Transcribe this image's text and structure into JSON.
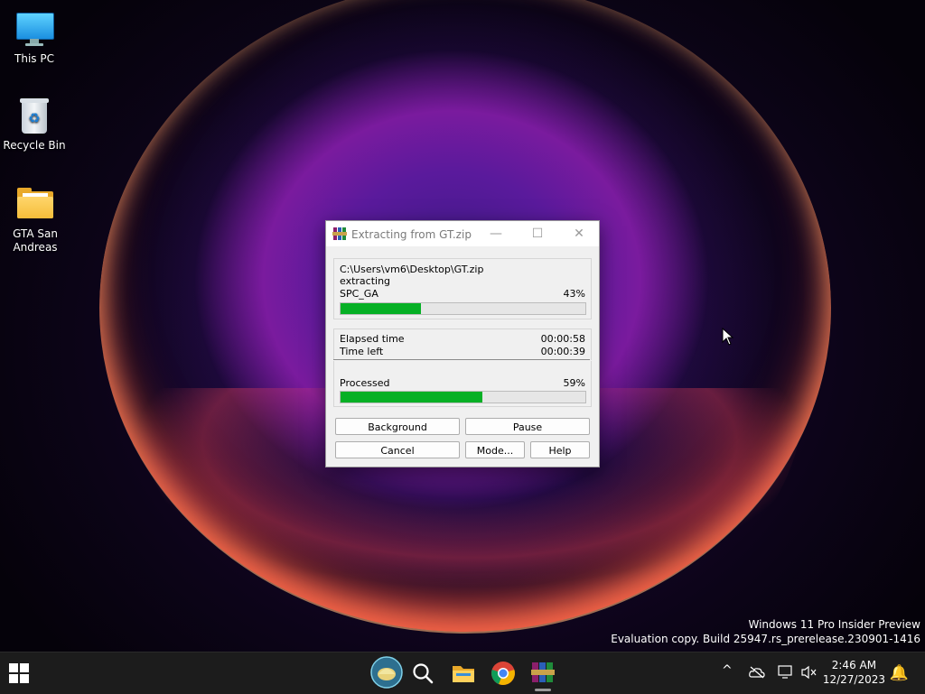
{
  "desktop": {
    "icons": [
      {
        "label": "This PC"
      },
      {
        "label": "Recycle Bin"
      },
      {
        "label": "GTA San Andreas"
      }
    ]
  },
  "dialog": {
    "title": "Extracting from GT.zip",
    "archive_path": "C:\\Users\\vm6\\Desktop\\GT.zip",
    "operation": "extracting",
    "current_file": "SPC_GA",
    "file_percent_label": "43%",
    "file_progress": 0.33,
    "elapsed_label": "Elapsed time",
    "elapsed_value": "00:00:58",
    "timeleft_label": "Time left",
    "timeleft_value": "00:00:39",
    "processed_label": "Processed",
    "processed_percent_label": "59%",
    "processed_progress": 0.58,
    "buttons": {
      "background": "Background",
      "pause": "Pause",
      "cancel": "Cancel",
      "mode": "Mode...",
      "help": "Help"
    },
    "progress_color": "#06b025"
  },
  "watermark": {
    "line1": "Windows 11 Pro Insider Preview",
    "line2": "Evaluation copy. Build 25947.rs_prerelease.230901-1416"
  },
  "taskbar": {
    "pinned": [
      "start-icon",
      "widgets-icon",
      "search-icon",
      "file-explorer-icon",
      "chrome-icon",
      "winrar-icon"
    ],
    "clock_time": "2:46 AM",
    "clock_date": "12/27/2023"
  }
}
